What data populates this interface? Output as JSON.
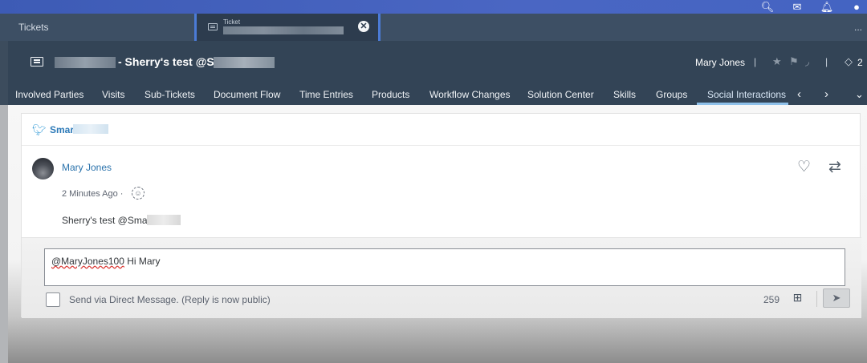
{
  "shell": {
    "icons": [
      "search-icon",
      "feedback-icon",
      "notifications-icon",
      "user-icon"
    ]
  },
  "tabs": {
    "tickets": "Tickets",
    "ticket_caption": "Ticket",
    "more": "..."
  },
  "header": {
    "title": "- Sherry's test @S",
    "user": "Mary Jones",
    "separator": "|",
    "count": "2"
  },
  "nav": {
    "items": [
      "Involved Parties",
      "Visits",
      "Sub-Tickets",
      "Document Flow",
      "Time Entries",
      "Products",
      "Workflow Changes",
      "Solution Center",
      "Skills",
      "Groups",
      "Social Interactions"
    ],
    "active": "Social Interactions"
  },
  "interaction": {
    "account": "Smar",
    "post": {
      "author": "Mary Jones",
      "time": "2 Minutes Ago ·",
      "text": "Sherry's test @Smar"
    },
    "reply": {
      "mention": "@MaryJones100",
      "text": " Hi Mary",
      "dm_label": "Send via Direct Message.  (Reply is now public)",
      "char_count": "259"
    }
  },
  "colors": {
    "shell": "#4a66c3",
    "header": "#334456",
    "link": "#2b73ac",
    "active_tab_underline": "#8fc1ea"
  }
}
